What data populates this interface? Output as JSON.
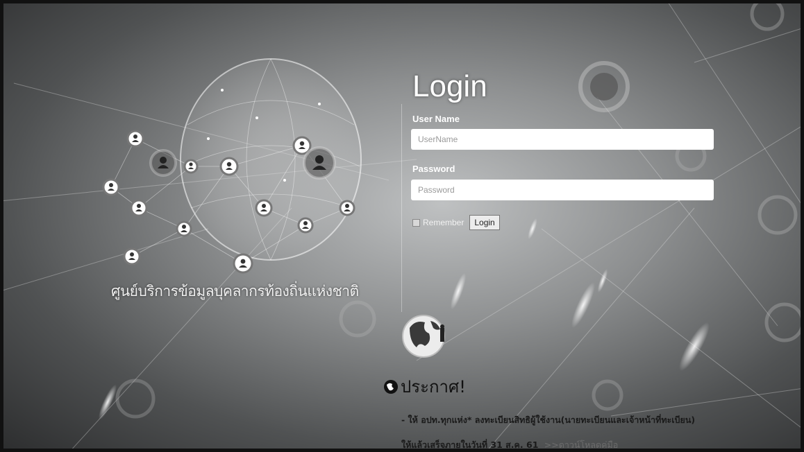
{
  "tagline": "ศูนย์บริการข้อมูลบุคลากรท้องถิ่นแห่งชาติ",
  "login": {
    "title": "Login",
    "username_label": "User Name",
    "username_placeholder": "UserName",
    "password_label": "Password",
    "password_placeholder": "Password",
    "remember_label": "Remember",
    "login_button": "Login"
  },
  "announcement": {
    "title": "ประกาศ!",
    "line1": "- ให้ อปท.ทุกแห่ง* ลงทะเบียนสิทธิผู้ใช้งาน(นายทะเบียนและเจ้าหน้าที่ทะเบียน)",
    "line2": "ให้แล้วเสร็จภายในวันที่ 31 ส.ค. 61",
    "download_link": ">>ดาวน์โหลดคู่มือ"
  },
  "icons": {
    "globe": "network-globe-icon",
    "earth": "earth-icon",
    "announce": "globe-bullet-icon",
    "person": "person-node-icon"
  },
  "colors": {
    "page_bg": "#8d8f90",
    "text_light": "#ffffff",
    "announce_text": "#111111",
    "link": "#6d6d6d"
  }
}
